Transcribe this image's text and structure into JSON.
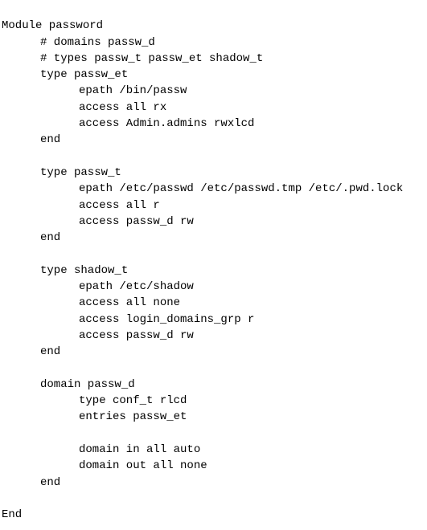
{
  "lines": [
    {
      "indent": 0,
      "text": "Module password"
    },
    {
      "indent": 1,
      "text": "# domains passw_d"
    },
    {
      "indent": 1,
      "text": "# types passw_t passw_et shadow_t"
    },
    {
      "indent": 1,
      "text": "type passw_et"
    },
    {
      "indent": 2,
      "text": "epath /bin/passw"
    },
    {
      "indent": 2,
      "text": "access all rx"
    },
    {
      "indent": 2,
      "text": "access Admin.admins rwxlcd"
    },
    {
      "indent": 1,
      "text": "end"
    },
    {
      "indent": 0,
      "text": ""
    },
    {
      "indent": 1,
      "text": "type passw_t"
    },
    {
      "indent": 2,
      "text": "epath /etc/passwd /etc/passwd.tmp /etc/.pwd.lock"
    },
    {
      "indent": 2,
      "text": "access all r"
    },
    {
      "indent": 2,
      "text": "access passw_d rw"
    },
    {
      "indent": 1,
      "text": "end"
    },
    {
      "indent": 0,
      "text": ""
    },
    {
      "indent": 1,
      "text": "type shadow_t"
    },
    {
      "indent": 2,
      "text": "epath /etc/shadow"
    },
    {
      "indent": 2,
      "text": "access all none"
    },
    {
      "indent": 2,
      "text": "access login_domains_grp r"
    },
    {
      "indent": 2,
      "text": "access passw_d rw"
    },
    {
      "indent": 1,
      "text": "end"
    },
    {
      "indent": 0,
      "text": ""
    },
    {
      "indent": 1,
      "text": "domain passw_d"
    },
    {
      "indent": 2,
      "text": "type conf_t rlcd"
    },
    {
      "indent": 2,
      "text": "entries passw_et"
    },
    {
      "indent": 0,
      "text": ""
    },
    {
      "indent": 2,
      "text": "domain in all auto"
    },
    {
      "indent": 2,
      "text": "domain out all none"
    },
    {
      "indent": 1,
      "text": "end"
    },
    {
      "indent": 0,
      "text": ""
    },
    {
      "indent": 0,
      "text": "End"
    }
  ]
}
